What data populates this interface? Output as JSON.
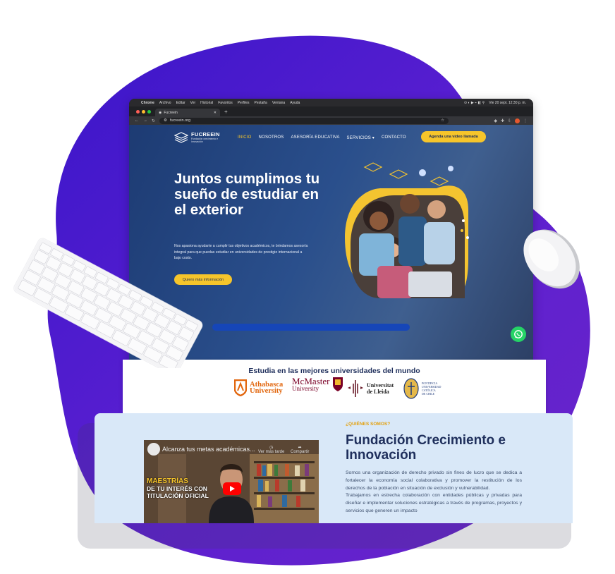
{
  "mac_menu": {
    "app": "Chrome",
    "items": [
      "Archivo",
      "Editar",
      "Ver",
      "Historial",
      "Favoritos",
      "Perfiles",
      "Pestaña",
      "Ventana",
      "Ayuda"
    ],
    "clock": "Vie 20 sept. 12:30 p. m."
  },
  "browser": {
    "tab_title": "Fucreein",
    "url": "fucreein.org"
  },
  "site": {
    "logo_title": "FUCREEIN",
    "logo_sub": "Fundación crecimiento e innovación",
    "nav": [
      "INICIO",
      "NOSOTROS",
      "ASESORÍA EDUCATIVA",
      "SERVICIOS",
      "CONTACTO"
    ],
    "cta": "Agenda una video llamada",
    "hero_title": "Juntos cumplimos tu sueño de estudiar en el exterior",
    "hero_text": "Nos apasiona ayudarte a cumplir tus objetivos académicos, te brindamos asesoría integral para que puedas estudiar en universidades de prestigio internacional a bajo costo.",
    "hero_button": "Quiero más información"
  },
  "universities": {
    "title": "Estudia en las mejores universidades del mundo",
    "athabasca": [
      "Athabasca",
      "University"
    ],
    "mcmaster": [
      "McMaster",
      "University"
    ],
    "lleida": [
      "Universitat",
      "de Lleida"
    ],
    "catolica": [
      "PONTIFICIA",
      "UNIVERSIDAD",
      "CATÓLICA",
      "DE CHILE"
    ]
  },
  "about": {
    "kicker": "¿QUIÉNES SOMOS?",
    "title": "Fundación Crecimiento e Innovación",
    "p1": "Somos una organización de derecho privado sin fines de lucro que se dedica a fortalecer la economía social colaborativa y promover la restitución de los derechos de la población en situación de exclusión y vulnerabilidad.",
    "p2": "Trabajamos en estrecha colaboración con entidades públicas y privadas para diseñar e implementar soluciones estratégicas a través de programas, proyectos y servicios que generen un impacto",
    "video_title": "Alcanza tus metas académicas...",
    "watch_later": "Ver más tarde",
    "share": "Compartir",
    "video_overlay": [
      "MAESTRÍAS",
      "DE TU INTERÉS CON",
      "TITULACIÓN OFICIAL"
    ]
  },
  "colors": {
    "purple": "#5b1fd1",
    "navy": "#1f2f5c",
    "yellow": "#f6c52b",
    "whatsapp": "#25d366"
  }
}
